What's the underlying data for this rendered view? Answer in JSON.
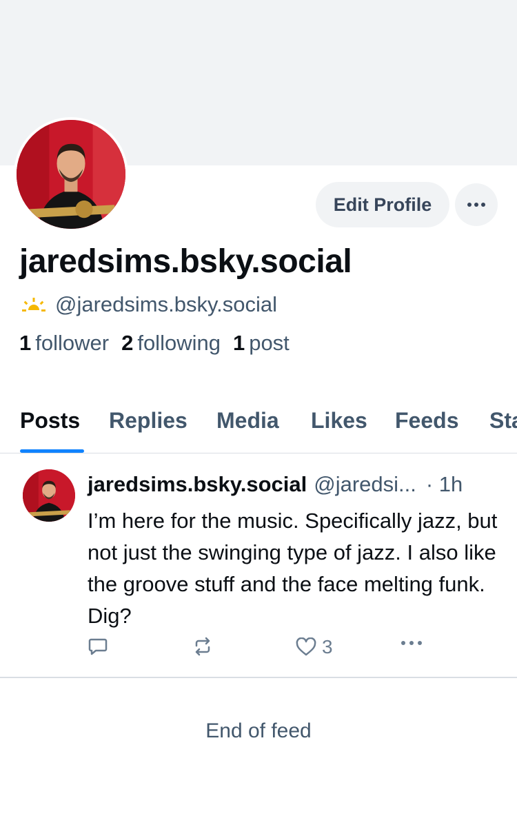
{
  "profile": {
    "display_name": "jaredsims.bsky.social",
    "handle": "@jaredsims.bsky.social",
    "handle_icon": "sun-icon",
    "stats": {
      "followers_count": "1",
      "followers_label": "follower",
      "following_count": "2",
      "following_label": "following",
      "posts_count": "1",
      "posts_label": "post"
    },
    "edit_label": "Edit Profile"
  },
  "tabs": [
    {
      "label": "Posts",
      "active": true
    },
    {
      "label": "Replies"
    },
    {
      "label": "Media"
    },
    {
      "label": "Likes"
    },
    {
      "label": "Feeds"
    },
    {
      "label": "Starter Packs"
    }
  ],
  "post": {
    "author_name": "jaredsims.bsky.social",
    "author_handle": "@jaredsi...",
    "time": "· 1h",
    "text": "I’m here for the music. Specifically jazz, but not just the swinging type of jazz. I also like the groove stuff and the face melting funk. Dig?",
    "like_count": "3"
  },
  "feed": {
    "end_label": "End of feed"
  },
  "colors": {
    "accent": "#1083fe",
    "banner": "#f1f3f5",
    "muted_text": "#42576c",
    "sun_icon": "#f5b800"
  }
}
